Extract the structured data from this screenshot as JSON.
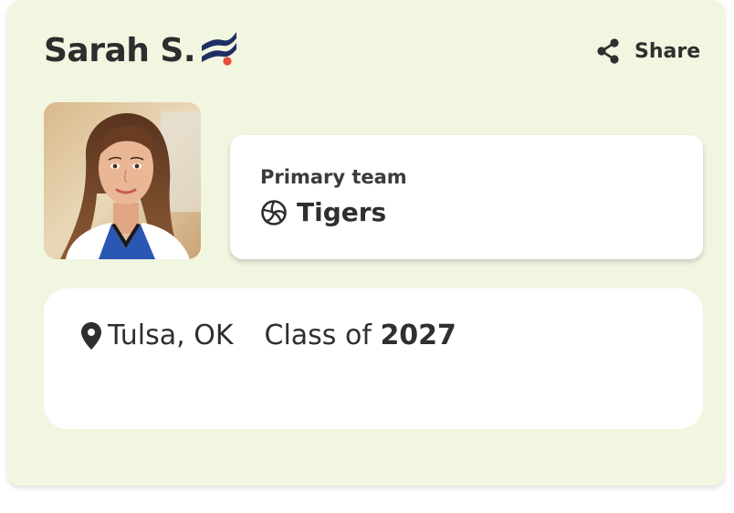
{
  "profile": {
    "name": "Sarah S.",
    "share_label": "Share",
    "primary_team_caption": "Primary team",
    "team_name": "Tigers",
    "location": "Tulsa, OK",
    "class_prefix": "Class of",
    "class_year": "2027"
  },
  "icons": {
    "brand": "brand-logo-icon",
    "share": "share-icon",
    "team": "volleyball-icon",
    "location": "map-pin-icon"
  },
  "colors": {
    "card_background": "#f1f6e1",
    "brand_navy": "#1f2e63",
    "brand_accent": "#e74c3c",
    "text": "#2f2f2f"
  }
}
